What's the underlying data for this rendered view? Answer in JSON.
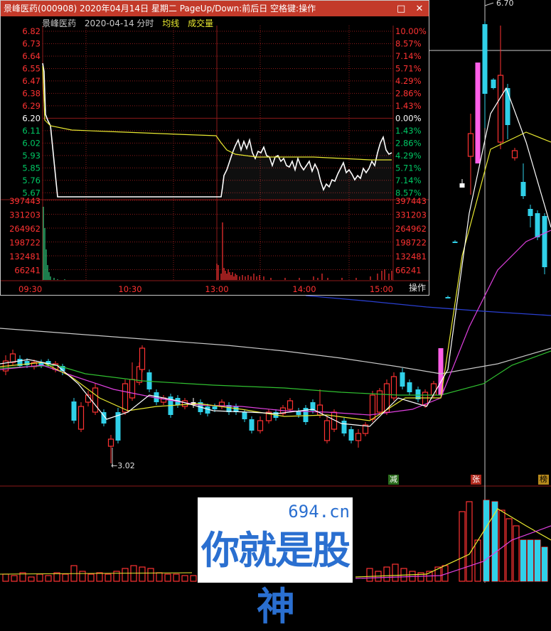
{
  "popup": {
    "title": "景峰医药(000908)  2020年04月14日  星期二  PageUp/Down:前后日  空格键:操作",
    "minimize_glyph": "□",
    "close_glyph": "✕",
    "stock_name": "景峰医药",
    "date_label": "2020-04-14 分时",
    "avg_line_label": "均线",
    "volume_label": "成交量",
    "operate_button": "操作",
    "price_ticks": [
      "6.82",
      "6.73",
      "6.64",
      "6.55",
      "6.47",
      "6.38",
      "6.29",
      "6.20",
      "6.11",
      "6.02",
      "5.93",
      "5.85",
      "5.76",
      "5.67"
    ],
    "pct_ticks": [
      "10.00%",
      "8.57%",
      "7.14%",
      "5.71%",
      "4.29%",
      "2.86%",
      "1.43%",
      "0.00%",
      "1.43%",
      "2.86%",
      "4.29%",
      "5.71%",
      "7.14%",
      "8.57%"
    ],
    "volume_ticks": [
      "397443",
      "331203",
      "264962",
      "198722",
      "132481",
      "66241"
    ],
    "time_ticks": [
      "09:30",
      "10:30",
      "13:00",
      "14:00",
      "15:00"
    ],
    "colors": {
      "up": "#ff3232",
      "down": "#00c864",
      "neutral": "#ffffff",
      "avg": "#e8e830",
      "grid": "#8b1a1a"
    }
  },
  "main_chart": {
    "high_label": "6.70",
    "low_label": "←3.02",
    "tags": [
      "减",
      "张",
      "榜"
    ],
    "colors": {
      "ma5": "#ffffff",
      "ma10": "#e8e830",
      "ma20": "#e040e0",
      "ma60": "#30c030",
      "ma120": "#c8c8c8",
      "ma250": "#2a3fd0"
    }
  },
  "watermark": {
    "url": "694.cn",
    "text": "你就是股神"
  },
  "chart_data": {
    "type": "line",
    "title": "景峰医药 2020-04-14 分时",
    "x": [
      "09:30",
      "10:30",
      "13:00",
      "14:00",
      "15:00"
    ],
    "series": [
      {
        "name": "均线",
        "values": [
          6.55,
          6.09,
          6.08,
          5.95,
          5.93,
          5.92
        ]
      }
    ],
    "ylim": [
      5.67,
      6.82
    ],
    "prev_close": 6.2,
    "grid": true
  }
}
